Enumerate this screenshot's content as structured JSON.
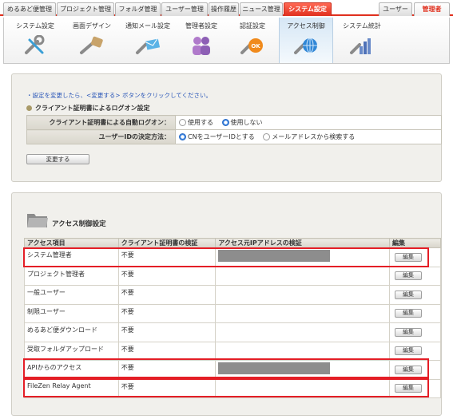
{
  "top_tabs": [
    {
      "label": "めるあど便管理",
      "state": "normal"
    },
    {
      "label": "プロジェクト管理",
      "state": "normal"
    },
    {
      "label": "フォルダ管理",
      "state": "normal"
    },
    {
      "label": "ユーザー管理",
      "state": "normal"
    },
    {
      "label": "操作履歴",
      "state": "normal"
    },
    {
      "label": "ニュース管理",
      "state": "normal"
    },
    {
      "label": "システム設定",
      "state": "active"
    },
    {
      "label": "ユーザー",
      "state": "normal"
    },
    {
      "label": "管理者",
      "state": "admin"
    }
  ],
  "subnav": [
    {
      "label": "システム設定",
      "icon": "wrench-screwdriver-icon",
      "active": false
    },
    {
      "label": "画面デザイン",
      "icon": "design-tag-icon",
      "active": false
    },
    {
      "label": "通知メール設定",
      "icon": "mail-icon",
      "active": false
    },
    {
      "label": "管理者設定",
      "icon": "admins-icon",
      "active": false
    },
    {
      "label": "認証設定",
      "icon": "auth-ok-icon",
      "active": false
    },
    {
      "label": "アクセス制御",
      "icon": "access-globe-icon",
      "active": true
    },
    {
      "label": "システム統計",
      "icon": "stats-chart-icon",
      "active": false
    }
  ],
  "panel1": {
    "hint": "・設定を変更したら、<変更する> ボタンをクリックしてください。",
    "section_title": "クライアント証明書によるログオン設定",
    "rows": [
      {
        "label": "クライアント証明書による自動ログオン：",
        "options": [
          {
            "text": "使用する",
            "checked": false
          },
          {
            "text": "使用しない",
            "checked": true
          }
        ]
      },
      {
        "label": "ユーザーIDの決定方法：",
        "options": [
          {
            "text": "CNをユーザーIDとする",
            "checked": true
          },
          {
            "text": "メールアドレスから検索する",
            "checked": false
          }
        ]
      }
    ],
    "change_button": "変更する"
  },
  "panel2": {
    "section_title": "アクセス制御設定",
    "headers": [
      "アクセス項目",
      "クライアント証明書の検証",
      "アクセス元IPアドレスの検証",
      "編集"
    ],
    "edit_label": "編集",
    "rows": [
      {
        "item": "システム管理者",
        "cert": "不要",
        "ip_masked": true
      },
      {
        "item": "プロジェクト管理者",
        "cert": "不要",
        "ip_masked": false
      },
      {
        "item": "一般ユーザー",
        "cert": "不要",
        "ip_masked": false
      },
      {
        "item": "制限ユーザー",
        "cert": "不要",
        "ip_masked": false
      },
      {
        "item": "めるあど便ダウンロード",
        "cert": "不要",
        "ip_masked": false
      },
      {
        "item": "受取フォルダアップロード",
        "cert": "不要",
        "ip_masked": false
      },
      {
        "item": "APIからのアクセス",
        "cert": "不要",
        "ip_masked": true
      },
      {
        "item": "FileZen Relay Agent",
        "cert": "不要",
        "ip_masked": false
      }
    ]
  },
  "colors": {
    "accent_red": "#e0301e",
    "highlight": "#e41e26",
    "link_blue": "#2b57b8"
  }
}
